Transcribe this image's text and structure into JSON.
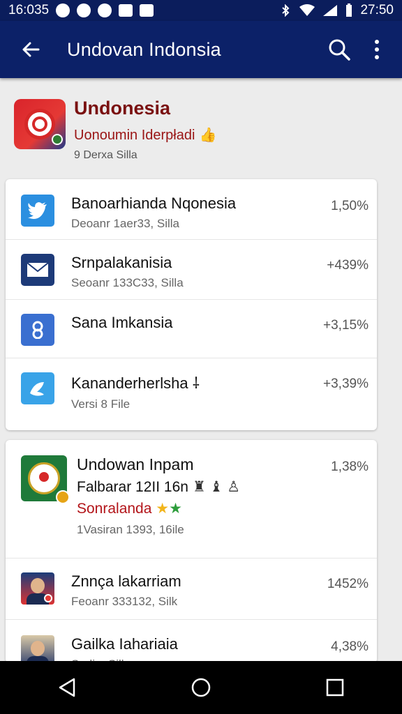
{
  "status_bar": {
    "time_left": "16:035",
    "time_right": "27:50"
  },
  "appbar": {
    "title": "Undovan Indonsia",
    "back_icon": "arrow-back-icon",
    "search_icon": "search-icon",
    "more_icon": "more-vert-icon"
  },
  "app": {
    "name": "Undonesia",
    "developer": "Uonoumin Iderpładi",
    "thumb": "👍",
    "meta": "9 Derxa Silla"
  },
  "list1": [
    {
      "title": "Banoarhianda Nqonesia",
      "subtitle": "Deoanr 1aer33, Silla",
      "value": "1,50%",
      "icon": "twitter-icon"
    },
    {
      "title": "Srnpalakanisia",
      "subtitle": "Seoanr 133C33, Silla",
      "value": "+439%",
      "icon": "mail-icon"
    },
    {
      "title": "Sana Imkansia",
      "subtitle": "",
      "value": "+3,15%",
      "icon": "user-icon"
    },
    {
      "title": "Kananderherlsha",
      "subtitle": "Versi  8 File",
      "value": "+3,39%",
      "icon": "fish-icon"
    }
  ],
  "list2_featured": {
    "title": "Undowan Inpam",
    "line2": "Falbarar 12II 16n",
    "line2_symbols": "♜ ♝ ♙",
    "line3": "Sonralanda",
    "line3_stars": [
      "★",
      "★"
    ],
    "subtitle": "1Vasiran 1393, 16ile",
    "value": "1,38%"
  },
  "list2": [
    {
      "title": "Znnça lakarriam",
      "subtitle": "Feoanr 333132, Silk",
      "value": "1452%"
    },
    {
      "title": "Gailka Iahariaia",
      "subtitle": "Sadi... Silla",
      "value": "4,38%"
    }
  ],
  "colors": {
    "appbar": "#0c2168",
    "statusbar": "#0b1d5c",
    "app_name": "#7a1010",
    "developer": "#9a1515",
    "background": "#ececec"
  },
  "navbar": {
    "back_icon": "nav-back-icon",
    "home_icon": "nav-home-icon",
    "recents_icon": "nav-recents-icon"
  }
}
